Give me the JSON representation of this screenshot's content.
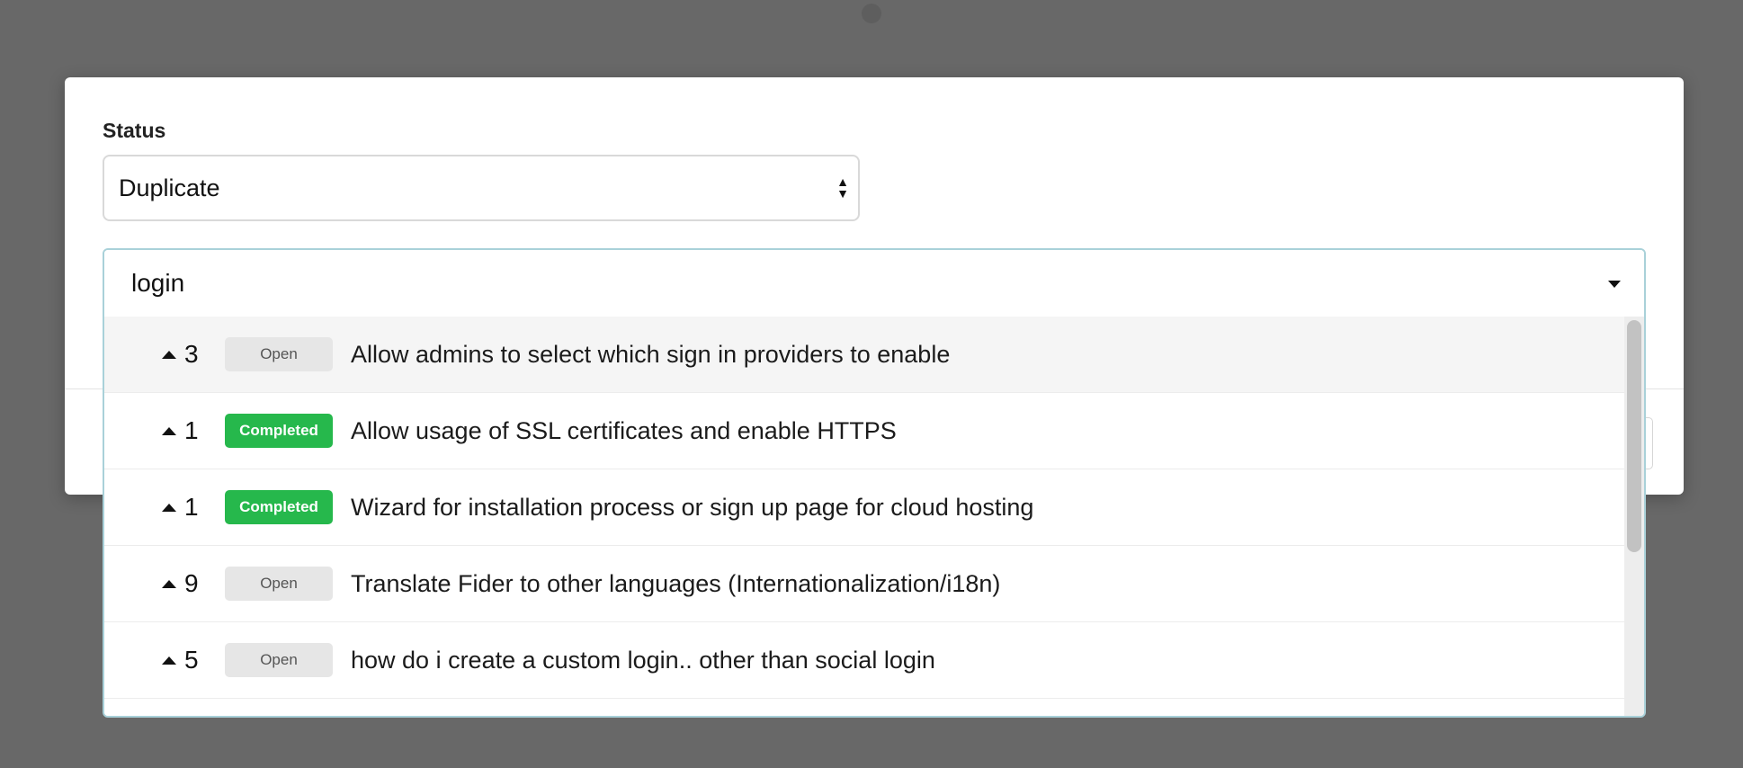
{
  "status": {
    "label": "Status",
    "selected": "Duplicate"
  },
  "search": {
    "value": "login"
  },
  "results": [
    {
      "votes": "3",
      "badge": "Open",
      "badge_type": "open",
      "title": "Allow admins to select which sign in providers to enable"
    },
    {
      "votes": "1",
      "badge": "Completed",
      "badge_type": "completed",
      "title": "Allow usage of SSL certificates and enable HTTPS"
    },
    {
      "votes": "1",
      "badge": "Completed",
      "badge_type": "completed",
      "title": "Wizard for installation process or sign up page for cloud hosting"
    },
    {
      "votes": "9",
      "badge": "Open",
      "badge_type": "open",
      "title": "Translate Fider to other languages (Internationalization/i18n)"
    },
    {
      "votes": "5",
      "badge": "Open",
      "badge_type": "open",
      "title": "how do i create a custom login.. other than social login"
    }
  ],
  "colors": {
    "completed": "#26b84c",
    "open": "#e6e6e6",
    "focus_border": "#a9d1d9"
  },
  "icons": {
    "select": "sort-arrows-icon",
    "combo": "caret-down-icon",
    "vote": "triangle-up-icon"
  }
}
